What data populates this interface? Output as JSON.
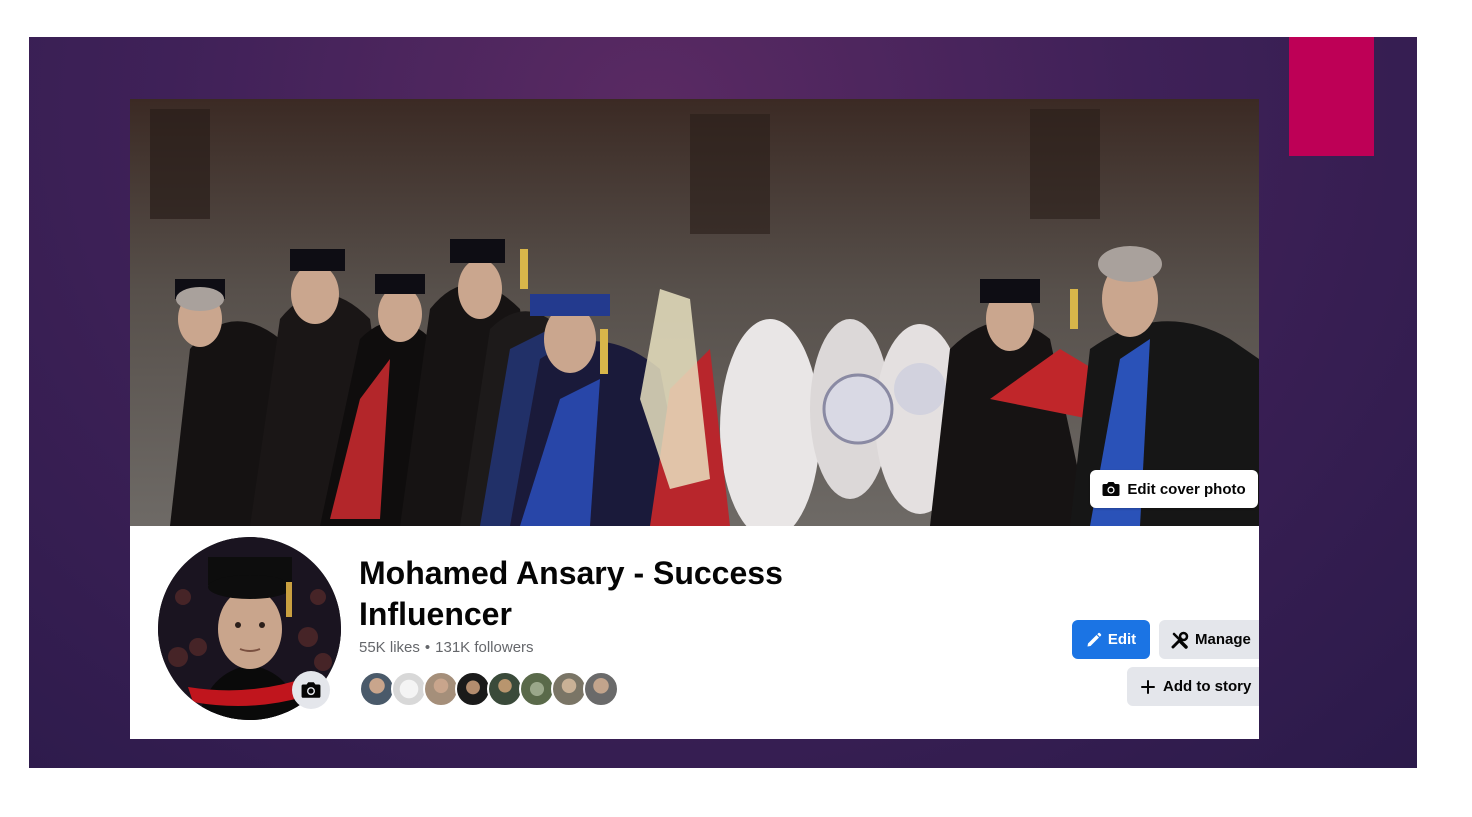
{
  "colors": {
    "slide_bg": "#3f2158",
    "accent": "#be0056",
    "primary_button": "#1b74e4",
    "secondary_button": "#e4e6eb",
    "subtext": "#65676b"
  },
  "cover": {
    "edit_label": "Edit cover photo",
    "icon": "camera-icon"
  },
  "profile": {
    "name": "Mohamed Ansary - Success Influencer",
    "likes": "55K likes",
    "separator": "•",
    "followers": "131K followers",
    "avatar_icon": "camera-icon",
    "friend_avatars": [
      "friend-1",
      "friend-2",
      "friend-3",
      "friend-4",
      "friend-5",
      "friend-6",
      "friend-7",
      "friend-8"
    ]
  },
  "actions": {
    "edit_label": "Edit",
    "edit_icon": "pencil-icon",
    "manage_label": "Manage",
    "manage_icon": "tools-icon",
    "add_story_label": "Add to story",
    "add_story_icon": "plus-icon"
  }
}
